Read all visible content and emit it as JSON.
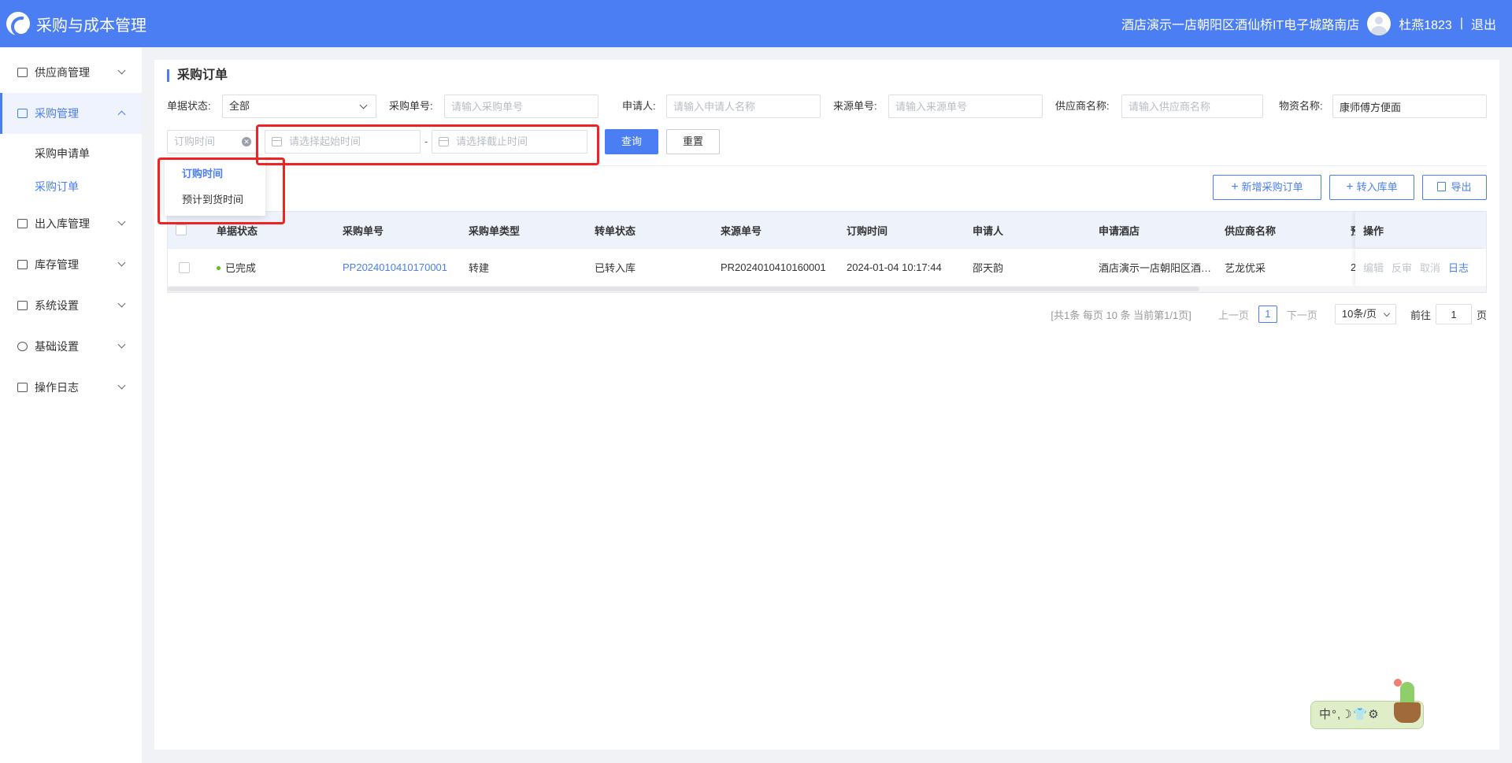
{
  "header": {
    "app_title": "采购与成本管理",
    "hotel_name": "酒店演示一店朝阳区酒仙桥IT电子城路南店",
    "user_name": "杜燕1823",
    "separator": "|",
    "logout_label": "退出"
  },
  "sidebar": {
    "items": [
      {
        "label": "供应商管理",
        "icon": "supplier-icon"
      },
      {
        "label": "采购管理",
        "icon": "purchase-icon",
        "open": true,
        "children": [
          {
            "label": "采购申请单"
          },
          {
            "label": "采购订单",
            "active": true
          }
        ]
      },
      {
        "label": "出入库管理",
        "icon": "inout-icon"
      },
      {
        "label": "库存管理",
        "icon": "inventory-icon"
      },
      {
        "label": "系统设置",
        "icon": "system-icon"
      },
      {
        "label": "基础设置",
        "icon": "gear-icon"
      },
      {
        "label": "操作日志",
        "icon": "log-icon"
      }
    ]
  },
  "page": {
    "title": "采购订单"
  },
  "filters": {
    "status_label": "单据状态:",
    "status_value": "全部",
    "po_no_label": "采购单号:",
    "po_no_placeholder": "请输入采购单号",
    "applicant_label": "申请人:",
    "applicant_placeholder": "请输入申请人名称",
    "source_no_label": "来源单号:",
    "source_no_placeholder": "请输入来源单号",
    "supplier_label": "供应商名称:",
    "supplier_placeholder": "请输入供应商名称",
    "material_label": "物资名称:",
    "material_value": "康师傅方便面",
    "time_type_placeholder": "订购时间",
    "start_placeholder": "请选择起始时间",
    "date_separator": "-",
    "end_placeholder": "请选择截止时间",
    "search_label": "查询",
    "reset_label": "重置"
  },
  "time_type_dropdown": {
    "options": [
      "订购时间",
      "预计到货时间"
    ],
    "selected": "订购时间"
  },
  "toolbar": {
    "add_label": "新增采购订单",
    "transfer_label": "转入库单",
    "export_label": "导出"
  },
  "table": {
    "columns": [
      "单据状态",
      "采购单号",
      "采购单类型",
      "转单状态",
      "来源单号",
      "订购时间",
      "申请人",
      "申请酒店",
      "供应商名称",
      "预",
      "操作"
    ],
    "rows": [
      {
        "status": "已完成",
        "po_no": "PP2024010410170001",
        "type": "转建",
        "transfer_status": "已转入库",
        "source_no": "PR2024010410160001",
        "order_time": "2024-01-04 10:17:44",
        "applicant": "邵天韵",
        "hotel": "酒店演示一店朝阳区酒仙桥IT电子城路南店",
        "supplier": "艺龙优采",
        "expected": "2",
        "ops": {
          "edit": "编辑",
          "reverse": "反审",
          "cancel": "取消",
          "log": "日志"
        }
      }
    ],
    "status_color": "#52c41a"
  },
  "pagination": {
    "summary": "[共1条 每页 10 条 当前第1/1页]",
    "prev_label": "上一页",
    "current_page": "1",
    "next_label": "下一页",
    "page_size": "10条/页",
    "goto_label": "前往",
    "goto_value": "1",
    "page_unit": "页"
  },
  "ime_widget": {
    "text": "中°,☽👕⚙"
  },
  "colors": {
    "primary": "#4a7ef2",
    "annotation": "#ee2424"
  }
}
